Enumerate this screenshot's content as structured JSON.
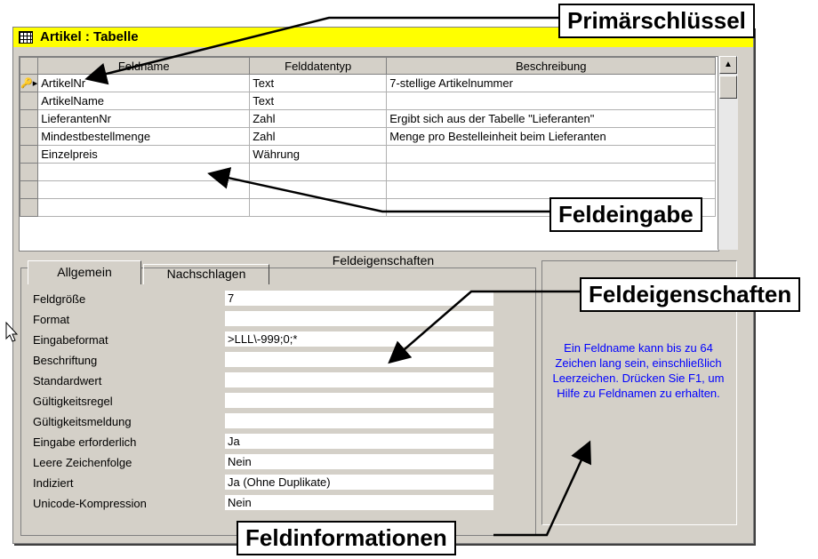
{
  "window": {
    "title": "Artikel : Tabelle",
    "columns": [
      "Feldname",
      "Felddatentyp",
      "Beschreibung"
    ],
    "rows": [
      {
        "marker": "🔑▸",
        "name": "ArtikelNr",
        "type": "Text",
        "desc": "7-stellige Artikelnummer"
      },
      {
        "marker": "",
        "name": "ArtikelName",
        "type": "Text",
        "desc": ""
      },
      {
        "marker": "",
        "name": "LieferantenNr",
        "type": "Zahl",
        "desc": "Ergibt sich aus der Tabelle \"Lieferanten\""
      },
      {
        "marker": "",
        "name": "Mindestbestellmenge",
        "type": "Zahl",
        "desc": "Menge pro Bestelleinheit beim Lieferanten"
      },
      {
        "marker": "",
        "name": "Einzelpreis",
        "type": "Währung",
        "desc": ""
      },
      {
        "marker": "",
        "name": "",
        "type": "",
        "desc": ""
      },
      {
        "marker": "",
        "name": "",
        "type": "",
        "desc": ""
      },
      {
        "marker": "",
        "name": "",
        "type": "",
        "desc": ""
      }
    ],
    "section_label": "Feldeigenschaften"
  },
  "tabs": {
    "general": "Allgemein",
    "lookup": "Nachschlagen"
  },
  "properties": [
    {
      "label": "Feldgröße",
      "value": "7"
    },
    {
      "label": "Format",
      "value": ""
    },
    {
      "label": "Eingabeformat",
      "value": ">LLL\\-999;0;*"
    },
    {
      "label": "Beschriftung",
      "value": ""
    },
    {
      "label": "Standardwert",
      "value": ""
    },
    {
      "label": "Gültigkeitsregel",
      "value": ""
    },
    {
      "label": "Gültigkeitsmeldung",
      "value": ""
    },
    {
      "label": "Eingabe erforderlich",
      "value": "Ja"
    },
    {
      "label": "Leere Zeichenfolge",
      "value": "Nein"
    },
    {
      "label": "Indiziert",
      "value": "Ja (Ohne Duplikate)"
    },
    {
      "label": "Unicode-Kompression",
      "value": "Nein"
    }
  ],
  "info_text": "Ein Feldname kann bis zu 64 Zeichen lang sein, einschließlich Leerzeichen. Drücken Sie F1, um Hilfe zu Feldnamen zu erhalten.",
  "callouts": {
    "primary_key": "Primärschlüssel",
    "field_entry": "Feldeingabe",
    "field_properties": "Feldeigenschaften",
    "field_info": "Feldinformationen"
  },
  "icons": [
    "table-icon",
    "key-icon",
    "row-selector-icon",
    "scroll-up-icon",
    "mouse-cursor-icon"
  ],
  "colors": {
    "titlebar": "#ffff00",
    "info_text": "#0000ff",
    "dialog_bg": "#d4d0c8"
  }
}
